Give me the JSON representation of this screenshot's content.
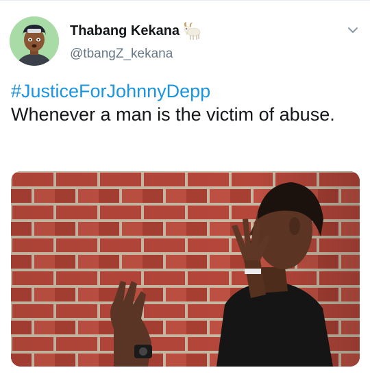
{
  "tweet": {
    "author": {
      "display_name": "Thabang Kekana",
      "handle": "@tbangZ_kekana",
      "badge_icon": "goat-emoji-icon"
    },
    "hashtag": "#JusticeForJohnnyDepp",
    "text": "Whenever a man is the victim of abuse.",
    "menu_icon": "chevron-down-icon",
    "media_icon": "man-talking-to-brick-wall-photo"
  },
  "colors": {
    "link": "#1b95e0",
    "text": "#14171a",
    "secondary": "#657786",
    "divider": "#e6ecf0",
    "brick": "#b74a3d",
    "mortar": "#c9b8a3"
  }
}
